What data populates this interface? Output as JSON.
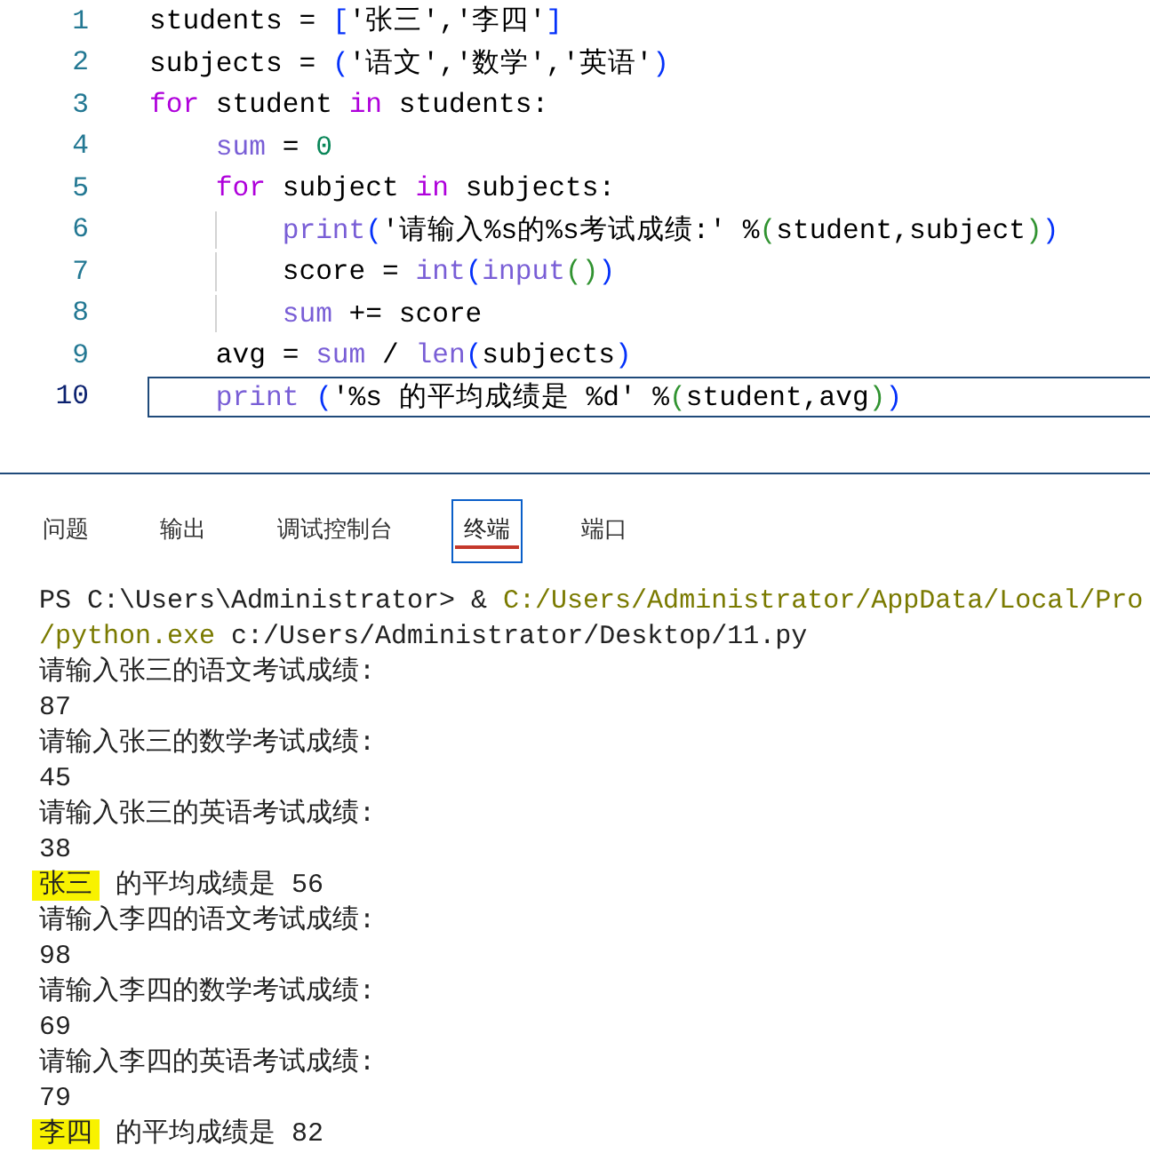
{
  "editor": {
    "lines": [
      {
        "number": "1",
        "current": false,
        "tokens": [
          {
            "text": "students = ",
            "kind": "plain"
          },
          {
            "text": "[",
            "kind": "bracket"
          },
          {
            "text": "'张三','李四'",
            "kind": "plain"
          },
          {
            "text": "]",
            "kind": "bracket"
          }
        ]
      },
      {
        "number": "2",
        "current": false,
        "tokens": [
          {
            "text": "subjects = ",
            "kind": "plain"
          },
          {
            "text": "(",
            "kind": "bracket"
          },
          {
            "text": "'语文','数学','英语'",
            "kind": "plain"
          },
          {
            "text": ")",
            "kind": "bracket"
          }
        ]
      },
      {
        "number": "3",
        "current": false,
        "tokens": [
          {
            "text": "for",
            "kind": "keyword"
          },
          {
            "text": " student ",
            "kind": "plain"
          },
          {
            "text": "in",
            "kind": "keyword"
          },
          {
            "text": " students:",
            "kind": "plain"
          }
        ]
      },
      {
        "number": "4",
        "current": false,
        "tokens": [
          {
            "text": "    sum",
            "kind": "builtin"
          },
          {
            "text": " = ",
            "kind": "plain"
          },
          {
            "text": "0",
            "kind": "number"
          }
        ]
      },
      {
        "number": "5",
        "current": false,
        "tokens": [
          {
            "text": "    for",
            "kind": "keyword"
          },
          {
            "text": " subject ",
            "kind": "plain"
          },
          {
            "text": "in",
            "kind": "keyword"
          },
          {
            "text": " subjects:",
            "kind": "plain"
          }
        ]
      },
      {
        "number": "6",
        "current": false,
        "tokens": [
          {
            "text": "        print",
            "kind": "builtin"
          },
          {
            "text": "(",
            "kind": "bracket"
          },
          {
            "text": "'请输入%s的%s考试成绩:' %",
            "kind": "plain"
          },
          {
            "text": "(",
            "kind": "bracket2"
          },
          {
            "text": "student,subject",
            "kind": "plain"
          },
          {
            "text": ")",
            "kind": "bracket2"
          },
          {
            "text": ")",
            "kind": "bracket"
          }
        ]
      },
      {
        "number": "7",
        "current": false,
        "tokens": [
          {
            "text": "        score = ",
            "kind": "plain"
          },
          {
            "text": "int",
            "kind": "builtin"
          },
          {
            "text": "(",
            "kind": "bracket"
          },
          {
            "text": "input",
            "kind": "builtin"
          },
          {
            "text": "(",
            "kind": "bracket2"
          },
          {
            "text": ")",
            "kind": "bracket2"
          },
          {
            "text": ")",
            "kind": "bracket"
          }
        ]
      },
      {
        "number": "8",
        "current": false,
        "tokens": [
          {
            "text": "        sum",
            "kind": "builtin"
          },
          {
            "text": " += score",
            "kind": "plain"
          }
        ]
      },
      {
        "number": "9",
        "current": false,
        "tokens": [
          {
            "text": "    avg = ",
            "kind": "plain"
          },
          {
            "text": "sum",
            "kind": "builtin"
          },
          {
            "text": " / ",
            "kind": "plain"
          },
          {
            "text": "len",
            "kind": "builtin"
          },
          {
            "text": "(",
            "kind": "bracket"
          },
          {
            "text": "subjects",
            "kind": "plain"
          },
          {
            "text": ")",
            "kind": "bracket"
          }
        ]
      },
      {
        "number": "10",
        "current": true,
        "tokens": [
          {
            "text": "    print",
            "kind": "builtin"
          },
          {
            "text": " (",
            "kind": "bracket"
          },
          {
            "text": "'%s 的平均成绩是 %d' %",
            "kind": "plain"
          },
          {
            "text": "(",
            "kind": "bracket2"
          },
          {
            "text": "student,avg",
            "kind": "plain"
          },
          {
            "text": ")",
            "kind": "bracket2"
          },
          {
            "text": ")",
            "kind": "bracket"
          }
        ]
      }
    ]
  },
  "panel": {
    "tabs": [
      {
        "label": "问题",
        "selected": false
      },
      {
        "label": "输出",
        "selected": false
      },
      {
        "label": "调试控制台",
        "selected": false
      },
      {
        "label": "终端",
        "selected": true
      },
      {
        "label": "端口",
        "selected": false
      }
    ]
  },
  "terminal": {
    "lines": [
      [
        {
          "text": "PS C:\\Users\\Administrator> & ",
          "kind": "plain"
        },
        {
          "text": "C:/Users/Administrator/AppData/Local/Pro",
          "kind": "path"
        }
      ],
      [
        {
          "text": "/python.exe",
          "kind": "path"
        },
        {
          "text": " c:/Users/Administrator/Desktop/11.py",
          "kind": "plain"
        }
      ],
      [
        {
          "text": "请输入张三的语文考试成绩:",
          "kind": "plain"
        }
      ],
      [
        {
          "text": "87",
          "kind": "plain"
        }
      ],
      [
        {
          "text": "请输入张三的数学考试成绩:",
          "kind": "plain"
        }
      ],
      [
        {
          "text": "45",
          "kind": "plain"
        }
      ],
      [
        {
          "text": "请输入张三的英语考试成绩:",
          "kind": "plain"
        }
      ],
      [
        {
          "text": "38",
          "kind": "plain"
        }
      ],
      [
        {
          "text": "张三",
          "kind": "highlight"
        },
        {
          "text": " 的平均成绩是 56",
          "kind": "plain"
        }
      ],
      [
        {
          "text": "请输入李四的语文考试成绩:",
          "kind": "plain"
        }
      ],
      [
        {
          "text": "98",
          "kind": "plain"
        }
      ],
      [
        {
          "text": "请输入李四的数学考试成绩:",
          "kind": "plain"
        }
      ],
      [
        {
          "text": "69",
          "kind": "plain"
        }
      ],
      [
        {
          "text": "请输入李四的英语考试成绩:",
          "kind": "plain"
        }
      ],
      [
        {
          "text": "79",
          "kind": "plain"
        }
      ],
      [
        {
          "text": "李四",
          "kind": "highlight"
        },
        {
          "text": " 的平均成绩是 82",
          "kind": "plain"
        }
      ]
    ]
  }
}
